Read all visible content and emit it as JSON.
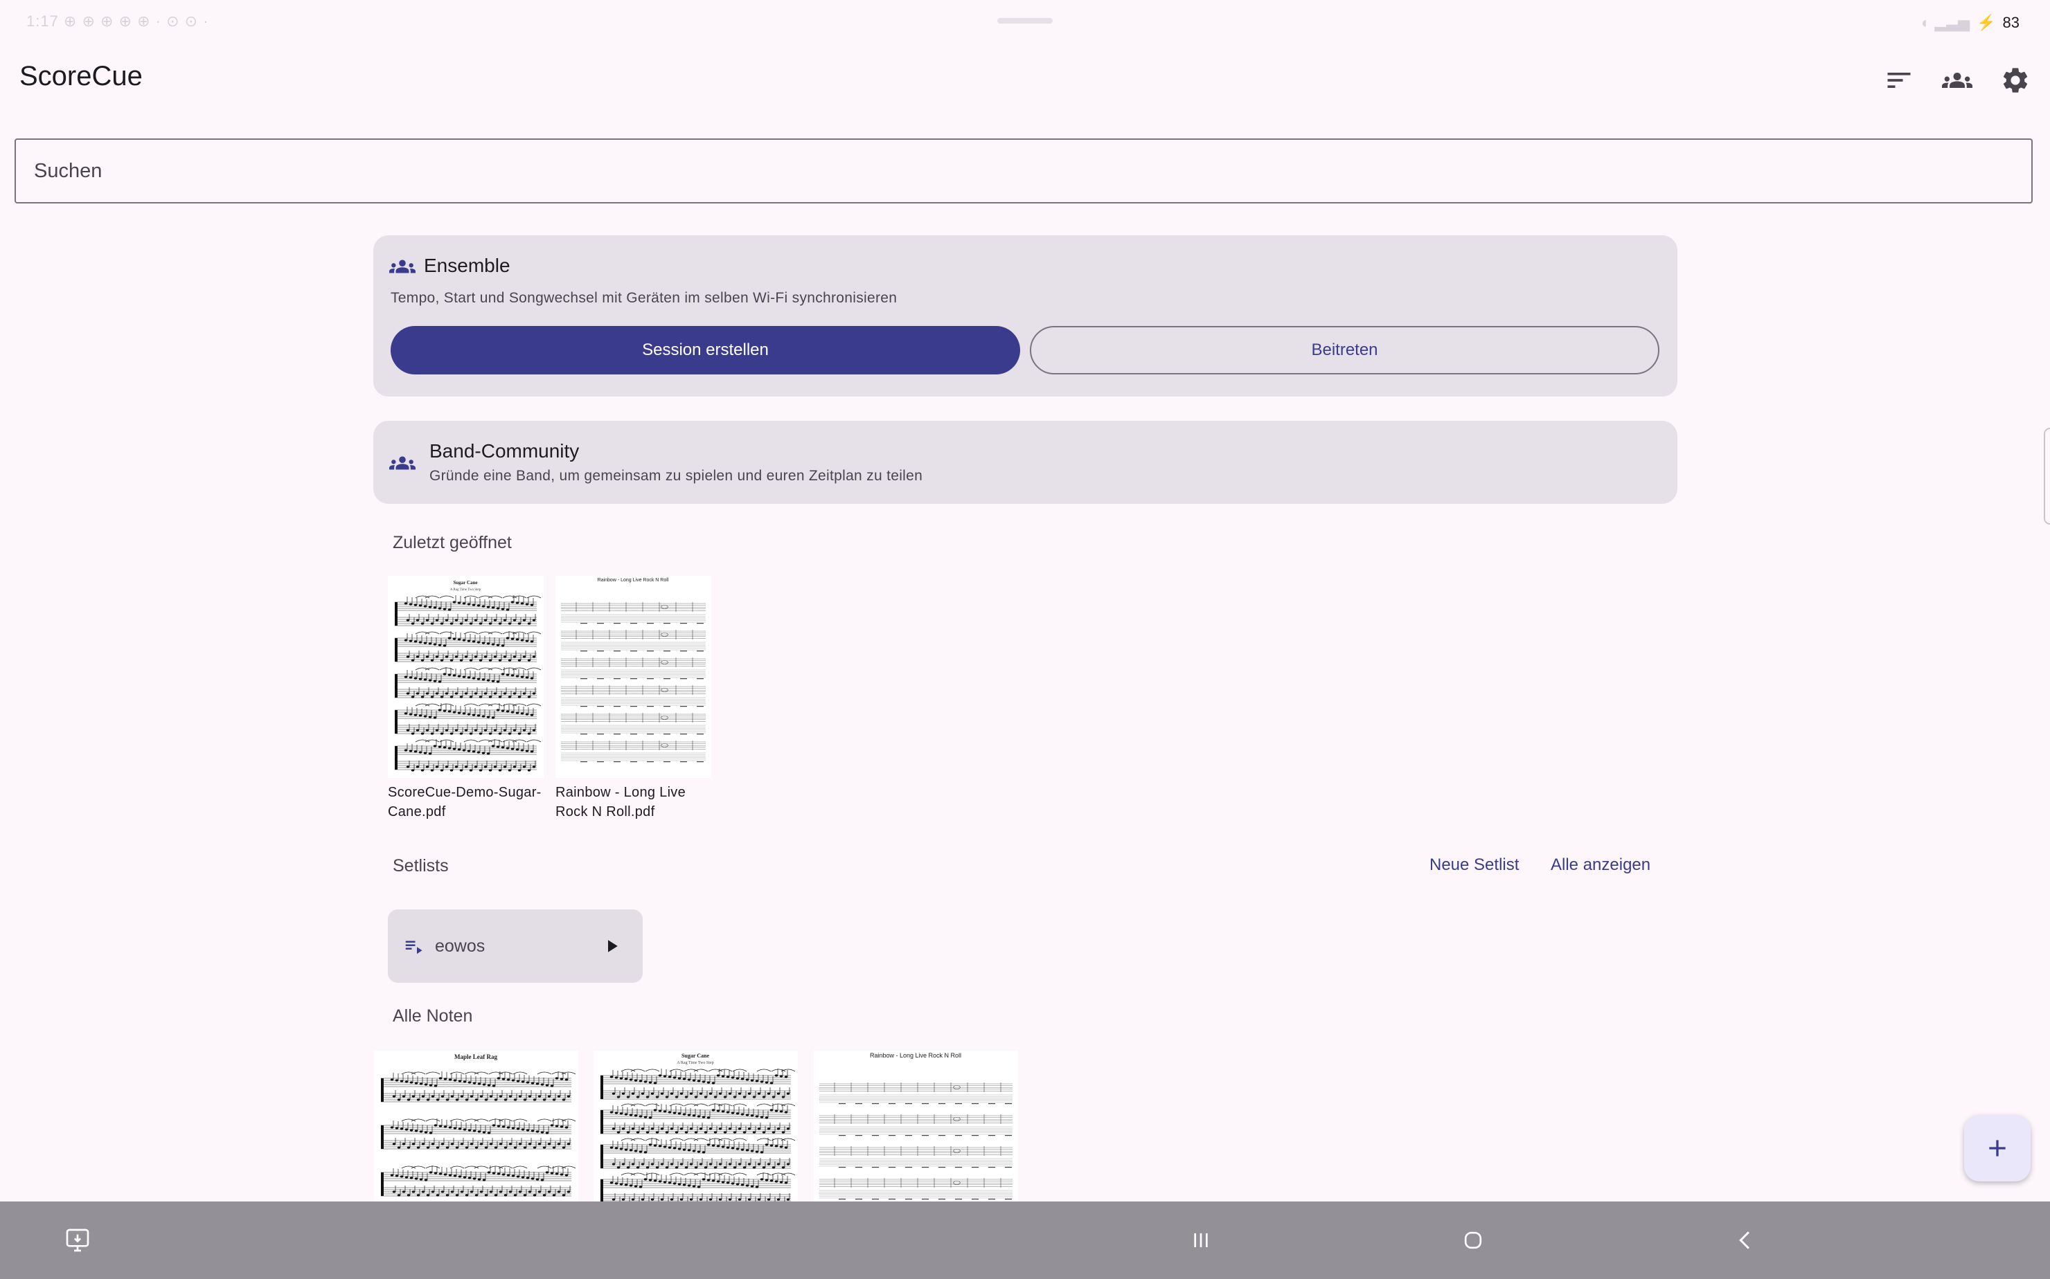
{
  "status": {
    "left_text": "1:17  ⊕ ⊕ ⊕ ⊕ ⊕  ·  ⊙ ⊙ ·",
    "battery": "83"
  },
  "app": {
    "title": "ScoreCue"
  },
  "toolbar": {
    "sort_icon": "sort-icon",
    "group_icon": "group-icon",
    "settings_icon": "gear-icon"
  },
  "search": {
    "placeholder": "Suchen",
    "value": ""
  },
  "ensemble": {
    "title": "Ensemble",
    "subtitle": "Tempo, Start und Songwechsel mit Geräten im selben Wi-Fi synchronisieren",
    "create_label": "Session erstellen",
    "join_label": "Beitreten"
  },
  "band": {
    "title": "Band-Community",
    "subtitle": "Gründe eine Band, um gemeinsam zu spielen und euren Zeitplan zu teilen"
  },
  "recent": {
    "title": "Zuletzt geöffnet",
    "items": [
      {
        "line1": "ScoreCue-Demo-Sugar-",
        "line2": "Cane.pdf",
        "sheet_title": "Sugar Cane",
        "sheet_subtitle": "A Rag Time Two Step"
      },
      {
        "line1": "Rainbow - Long Live",
        "line2": "Rock N Roll.pdf",
        "sheet_title": "Rainbow - Long Live Rock N Roll"
      }
    ]
  },
  "setlists": {
    "title": "Setlists",
    "new_label": "Neue Setlist",
    "show_all_label": "Alle anzeigen",
    "items": [
      {
        "name": "eowos"
      }
    ]
  },
  "all_scores": {
    "title": "Alle Noten",
    "items": [
      {
        "sheet_title": "Maple Leaf Rag"
      },
      {
        "sheet_title": "Sugar Cane",
        "sheet_subtitle": "A Rag Time Two Step"
      },
      {
        "sheet_title": "Rainbow - Long Live Rock N Roll"
      }
    ]
  },
  "colors": {
    "accent": "#3b3b8e",
    "background": "#fdf7fc",
    "card": "#e6e1e8",
    "nav": "#939097"
  }
}
